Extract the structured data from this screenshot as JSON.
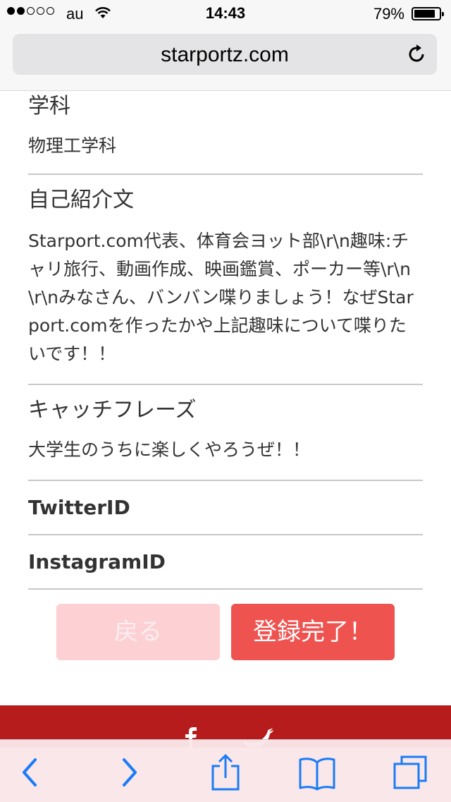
{
  "status_bar": {
    "carrier": "au",
    "time": "14:43",
    "battery": "79%",
    "battery_level": 0.79
  },
  "browser": {
    "url": "starportz.com",
    "reload_icon": "reload-icon"
  },
  "profile": {
    "department_label": "学科",
    "department_value": "物理工学科",
    "intro_label": "自己紹介文",
    "intro_value": "Starport.com代表、体育会ヨット部\\r\\n趣味:チャリ旅行、動画作成、映画鑑賞、ポーカー等\\r\\n\\r\\nみなさん、バンバン喋りましょう！なぜStarport.comを作ったかや上記趣味について喋りたいです！！",
    "catch_label": "キャッチフレーズ",
    "catch_value": "大学生のうちに楽しくやろうぜ！！",
    "twitter_label": "TwitterID",
    "instagram_label": "InstagramID"
  },
  "actions": {
    "back_label": "戻る",
    "done_label": "登録完了！"
  },
  "footer": {
    "icons": [
      "facebook-icon",
      "twitter-icon"
    ],
    "background": "#b71c1c"
  },
  "toolbar": {
    "icons": [
      "back-arrow-icon",
      "forward-arrow-icon",
      "share-icon",
      "bookmarks-icon",
      "tabs-icon"
    ],
    "icon_color": "#1a7cf6"
  },
  "colors": {
    "primary_button": "#ef5350",
    "secondary_button": "#fdd0d4"
  }
}
